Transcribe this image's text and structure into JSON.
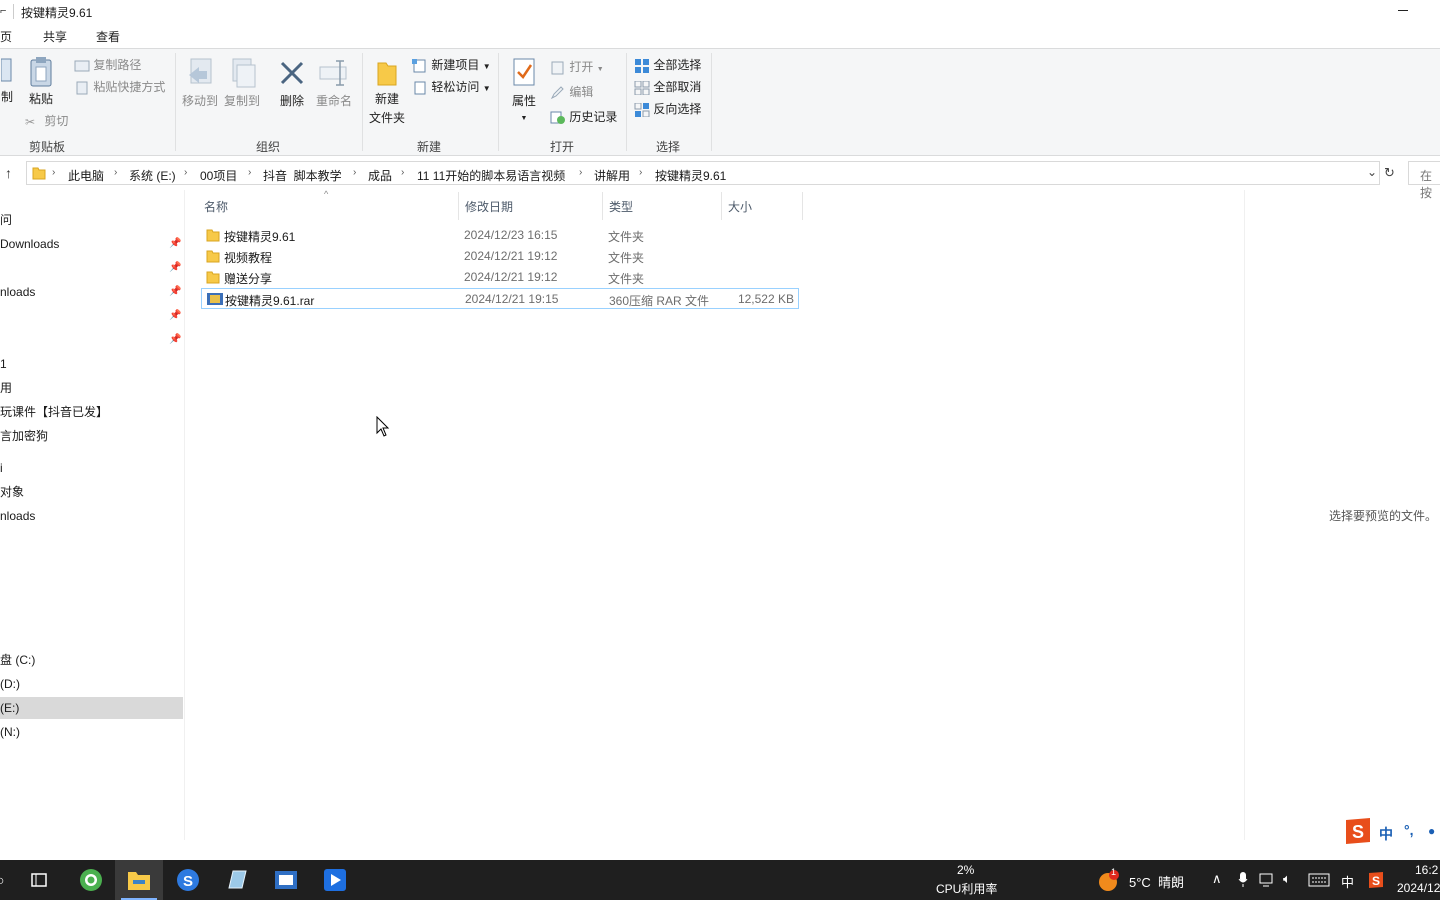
{
  "window": {
    "title": "按键精灵9.61"
  },
  "ribbon_tabs": [
    "页",
    "共享",
    "查看"
  ],
  "ribbon": {
    "clipboard": {
      "label": "剪贴板",
      "copy_partial": "制",
      "paste": "粘贴",
      "copy_path": "复制路径",
      "paste_shortcut": "粘贴快捷方式",
      "cut": "剪切"
    },
    "organize": {
      "label": "组织",
      "move_to": "移动到",
      "copy_to": "复制到",
      "delete": "删除",
      "rename": "重命名"
    },
    "new": {
      "label": "新建",
      "new_folder_line1": "新建",
      "new_folder_line2": "文件夹",
      "new_item": "新建项目",
      "easy_access": "轻松访问"
    },
    "open": {
      "label": "打开",
      "properties": "属性",
      "open": "打开",
      "edit": "编辑",
      "history": "历史记录"
    },
    "select": {
      "label": "选择",
      "select_all": "全部选择",
      "select_none": "全部取消",
      "invert": "反向选择"
    }
  },
  "address": {
    "crumbs": [
      "此电脑",
      "系统 (E:)",
      "00项目",
      "抖音  脚本教学",
      "成品",
      "11 11开始的脚本易语言视频",
      "讲解用",
      "按键精灵9.61"
    ],
    "search_placeholder": "在 按"
  },
  "nav": {
    "items": [
      "问",
      "Downloads",
      "nloads",
      "1",
      "用",
      "玩课件【抖音已发】",
      "言加密狗",
      "i",
      "对象",
      "nloads",
      "盘 (C:)",
      "(D:)",
      "(E:)",
      "(N:)"
    ]
  },
  "columns": {
    "name": "名称",
    "date": "修改日期",
    "type": "类型",
    "size": "大小"
  },
  "files": [
    {
      "name": "按键精灵9.61",
      "date": "2024/12/23 16:15",
      "type": "文件夹",
      "size": ""
    },
    {
      "name": "视频教程",
      "date": "2024/12/21 19:12",
      "type": "文件夹",
      "size": ""
    },
    {
      "name": "赠送分享",
      "date": "2024/12/21 19:12",
      "type": "文件夹",
      "size": ""
    },
    {
      "name": "按键精灵9.61.rar",
      "date": "2024/12/21 19:15",
      "type": "360压缩 RAR 文件",
      "size": "12,522 KB"
    }
  ],
  "preview": {
    "message": "选择要预览的文件。"
  },
  "ime": {
    "mode": "中"
  },
  "taskbar": {
    "cpu_percent": "2%",
    "cpu_label": "CPU利用率",
    "weather_badge": "1",
    "weather": "5°C  晴朗",
    "ime_lang": "中",
    "time": "16:2",
    "date": "2024/12"
  },
  "colors": {
    "folder": "#f7c948",
    "selection": "#99d1ff",
    "taskbar": "#1f1f1f",
    "ribbon": "#f5f6f7"
  }
}
